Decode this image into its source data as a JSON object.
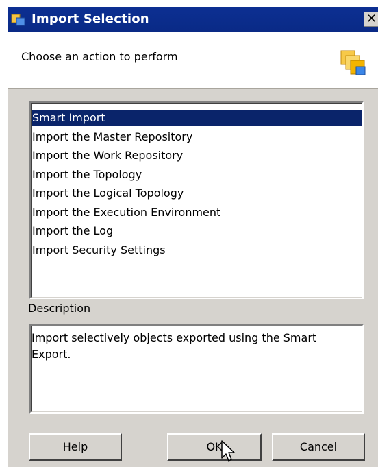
{
  "window": {
    "title": "Import Selection",
    "close_label": "✕",
    "header_text": "Choose an action to perform"
  },
  "actions": {
    "items": [
      "Smart Import",
      "Import the Master Repository",
      "Import the Work Repository",
      "Import the Topology",
      "Import the Logical Topology",
      "Import the Execution Environment",
      "Import the Log",
      "Import Security Settings"
    ],
    "selected": "Smart Import"
  },
  "description": {
    "label": "Description",
    "text": "Import selectively objects exported using the Smart Export."
  },
  "buttons": {
    "help": "Help",
    "ok": "OK",
    "cancel": "Cancel"
  },
  "colors": {
    "title_bar": "#0a2a86",
    "selection": "#0a246a",
    "dialog": "#d6d3ce"
  },
  "icons": [
    "window-app-icon",
    "import-wizard-icon",
    "mouse-pointer-icon"
  ]
}
